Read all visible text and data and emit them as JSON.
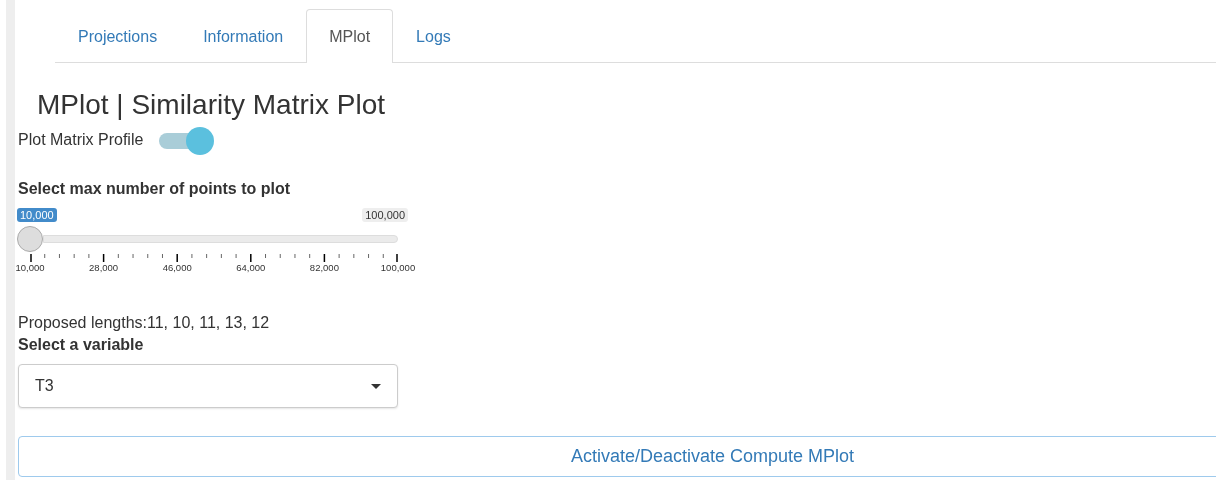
{
  "tabs": [
    {
      "label": "Projections",
      "selected": false
    },
    {
      "label": "Information",
      "selected": false
    },
    {
      "label": "MPlot",
      "selected": true
    },
    {
      "label": "Logs",
      "selected": false
    }
  ],
  "heading": "MPlot | Similarity Matrix Plot",
  "toggle": {
    "label": "Plot Matrix Profile",
    "on": true
  },
  "slider": {
    "label": "Select max number of points to plot",
    "value": "10,000",
    "max_label": "100,000",
    "level": 0,
    "ticks": [
      "10,000",
      "28,000",
      "46,000",
      "64,000",
      "82,000",
      "100,000"
    ]
  },
  "proposed_lengths": "Proposed lengths:11, 10, 11, 13, 12",
  "variable_select": {
    "label": "Select a variable",
    "value": "T3"
  },
  "compute_button": "Activate/Deactivate Compute MPlot"
}
